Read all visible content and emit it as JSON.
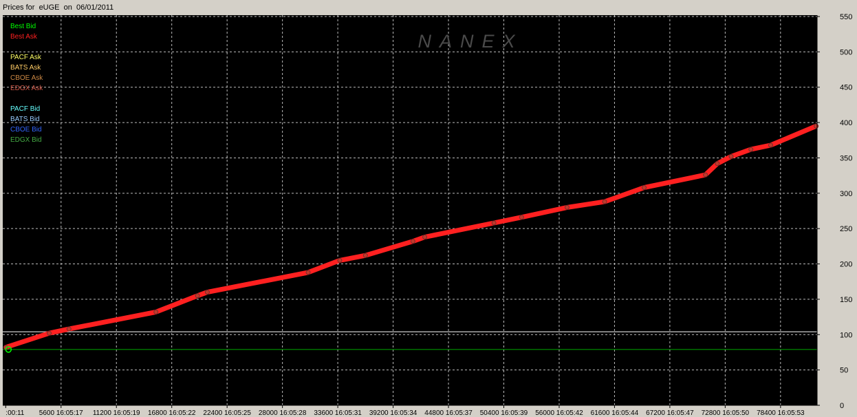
{
  "title": "Prices for  eUGE  on  06/01/2011",
  "watermark": "NANEX",
  "legend": [
    {
      "label": "Best Bid",
      "color": "#00ff00"
    },
    {
      "label": "Best Ask",
      "color": "#ff2020"
    },
    {
      "label": "",
      "color": "#000000"
    },
    {
      "label": "PACF Ask",
      "color": "#ffff66"
    },
    {
      "label": "BATS Ask",
      "color": "#ffcc66"
    },
    {
      "label": "CBOE Ask",
      "color": "#cc8844"
    },
    {
      "label": "EDGX Ask",
      "color": "#cc5544"
    },
    {
      "label": "",
      "color": "#000000"
    },
    {
      "label": "PACF Bid",
      "color": "#66ffff"
    },
    {
      "label": "BATS Bid",
      "color": "#99ccff"
    },
    {
      "label": "CBOE Bid",
      "color": "#3366ff"
    },
    {
      "label": "EDGX Bid",
      "color": "#44aa44"
    }
  ],
  "chart_data": {
    "type": "line",
    "title": "Prices for  eUGE  on  06/01/2011",
    "xlabel": "",
    "ylabel": "",
    "x_tick_labels": [
      ":00:11",
      "5600 16:05:17",
      "11200 16:05:19",
      "16800 16:05:22",
      "22400 16:05:25",
      "28000 16:05:28",
      "33600 16:05:31",
      "39200 16:05:34",
      "44800 16:05:37",
      "50400 16:05:39",
      "56000 16:05:42",
      "61600 16:05:44",
      "67200 16:05:47",
      "72800 16:05:50",
      "78400 16:05:53"
    ],
    "y_tick_labels": [
      "550",
      "500",
      "450",
      "400",
      "350",
      "300",
      "250",
      "200",
      "150",
      "100",
      "50",
      "0"
    ],
    "xlim": [
      -300,
      82100
    ],
    "ylim": [
      0,
      550
    ],
    "grid": true,
    "legend_position": "top-left",
    "series": [
      {
        "name": "Best Ask",
        "color": "#ff2020",
        "x": [
          0,
          4400,
          6400,
          15200,
          19400,
          20400,
          30600,
          33800,
          36400,
          41200,
          42400,
          49400,
          52200,
          56800,
          60600,
          64600,
          70800,
          72000,
          73400,
          75400,
          77400,
          82000
        ],
        "y": [
          82,
          102,
          108,
          132,
          155,
          160,
          188,
          205,
          212,
          232,
          238,
          258,
          266,
          280,
          288,
          308,
          326,
          342,
          352,
          362,
          368,
          395
        ]
      },
      {
        "name": "Best Bid",
        "color": "#00ff00",
        "x": [
          0
        ],
        "y": [
          79
        ]
      }
    ],
    "reference_lines": [
      {
        "y": 104,
        "color": "#ffffff"
      },
      {
        "y": 79,
        "color": "#00aa00"
      }
    ]
  }
}
